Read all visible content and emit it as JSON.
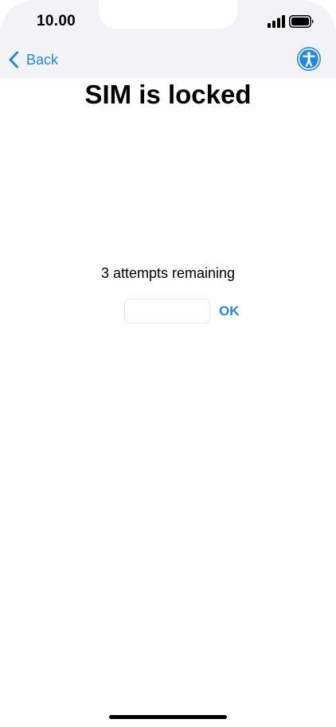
{
  "status_bar": {
    "time": "10.00",
    "signal_icon": "cellular-signal-icon",
    "battery_icon": "battery-full-icon"
  },
  "nav": {
    "back_label": "Back",
    "back_icon": "chevron-left-icon",
    "accessibility_icon": "accessibility-icon"
  },
  "main": {
    "title": "SIM is locked",
    "attempts_text": "3 attempts remaining",
    "pin_input": {
      "value": "",
      "placeholder": ""
    },
    "ok_label": "OK"
  },
  "colors": {
    "accent": "#2a86d8",
    "nav_background": "#f2f2f7",
    "background": "#ffffff"
  }
}
